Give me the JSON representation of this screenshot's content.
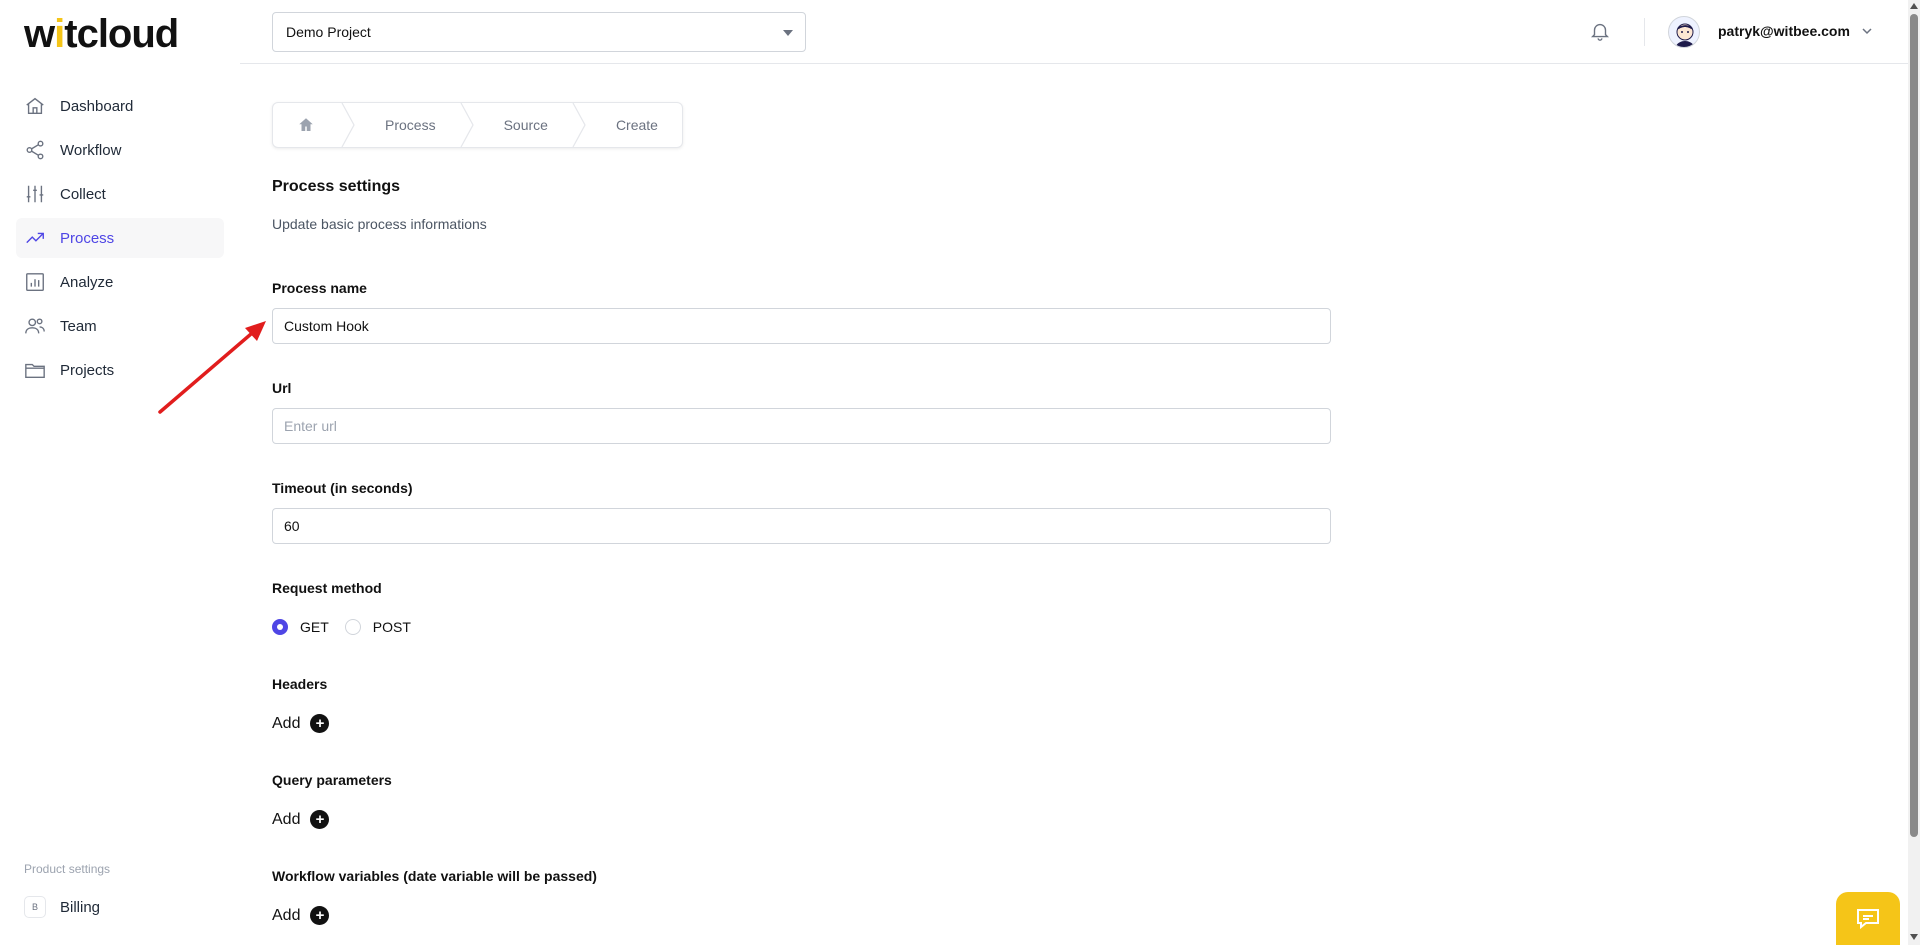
{
  "logo": {
    "text_pre": "w",
    "text_i": "i",
    "text_post": "tcloud"
  },
  "sidebar": {
    "items": [
      {
        "label": "Dashboard",
        "icon": "home-icon",
        "active": false
      },
      {
        "label": "Workflow",
        "icon": "share-icon",
        "active": false
      },
      {
        "label": "Collect",
        "icon": "sliders-icon",
        "active": false
      },
      {
        "label": "Process",
        "icon": "trending-up-icon",
        "active": true
      },
      {
        "label": "Analyze",
        "icon": "bar-chart-icon",
        "active": false
      },
      {
        "label": "Team",
        "icon": "users-icon",
        "active": false
      },
      {
        "label": "Projects",
        "icon": "folder-icon",
        "active": false
      }
    ],
    "product_settings_label": "Product settings",
    "billing": {
      "badge": "B",
      "label": "Billing"
    }
  },
  "header": {
    "project_select_value": "Demo Project",
    "user_email": "patryk@witbee.com"
  },
  "breadcrumb": {
    "items": [
      "Process",
      "Source",
      "Create"
    ]
  },
  "form": {
    "title": "Process settings",
    "subtitle": "Update basic process informations",
    "process_name": {
      "label": "Process name",
      "value": "Custom Hook"
    },
    "url": {
      "label": "Url",
      "value": "",
      "placeholder": "Enter url"
    },
    "timeout": {
      "label": "Timeout (in seconds)",
      "value": "60"
    },
    "request_method": {
      "label": "Request method",
      "options": [
        "GET",
        "POST"
      ],
      "selected": "GET"
    },
    "headers": {
      "label": "Headers",
      "add_label": "Add"
    },
    "query_parameters": {
      "label": "Query parameters",
      "add_label": "Add"
    },
    "workflow_variables": {
      "label": "Workflow variables (date variable will be passed)",
      "add_label": "Add"
    }
  },
  "colors": {
    "accent": "#4f46e5",
    "brand_yellow": "#f5c518",
    "annotation_red": "#e11d1d"
  }
}
